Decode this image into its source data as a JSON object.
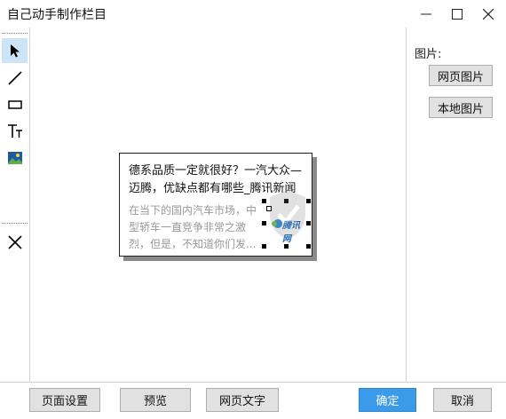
{
  "window": {
    "title": "自己动手制作栏目"
  },
  "tools": [
    {
      "name": "select-tool",
      "icon": "cursor-arrow-icon",
      "active": true
    },
    {
      "name": "line-tool",
      "icon": "line-icon",
      "active": false
    },
    {
      "name": "rect-tool",
      "icon": "rectangle-icon",
      "active": false
    },
    {
      "name": "text-tool",
      "icon": "text-tool-icon",
      "active": false
    },
    {
      "name": "image-tool",
      "icon": "image-icon",
      "active": false
    },
    {
      "name": "delete-tool",
      "icon": "close-x-icon",
      "active": false
    }
  ],
  "card": {
    "title": "德系品质一定就很好？一汽大众—迈腾，优缺点都有哪些_腾讯新闻",
    "desc": "在当下的国内汽车市场，中型轿车一直竞争非常之激烈，但是，不知道你们发...",
    "image_logo": "腾讯网"
  },
  "right_panel": {
    "label": "图片:",
    "web_image_button": "网页图片",
    "local_image_button": "本地图片"
  },
  "bottom": {
    "page_settings": "页面设置",
    "preview": "预览",
    "web_text": "网页文字",
    "ok": "确定",
    "cancel": "取消"
  },
  "colors": {
    "accent": "#3c9be9",
    "toolbar_active": "#cce4f7"
  }
}
